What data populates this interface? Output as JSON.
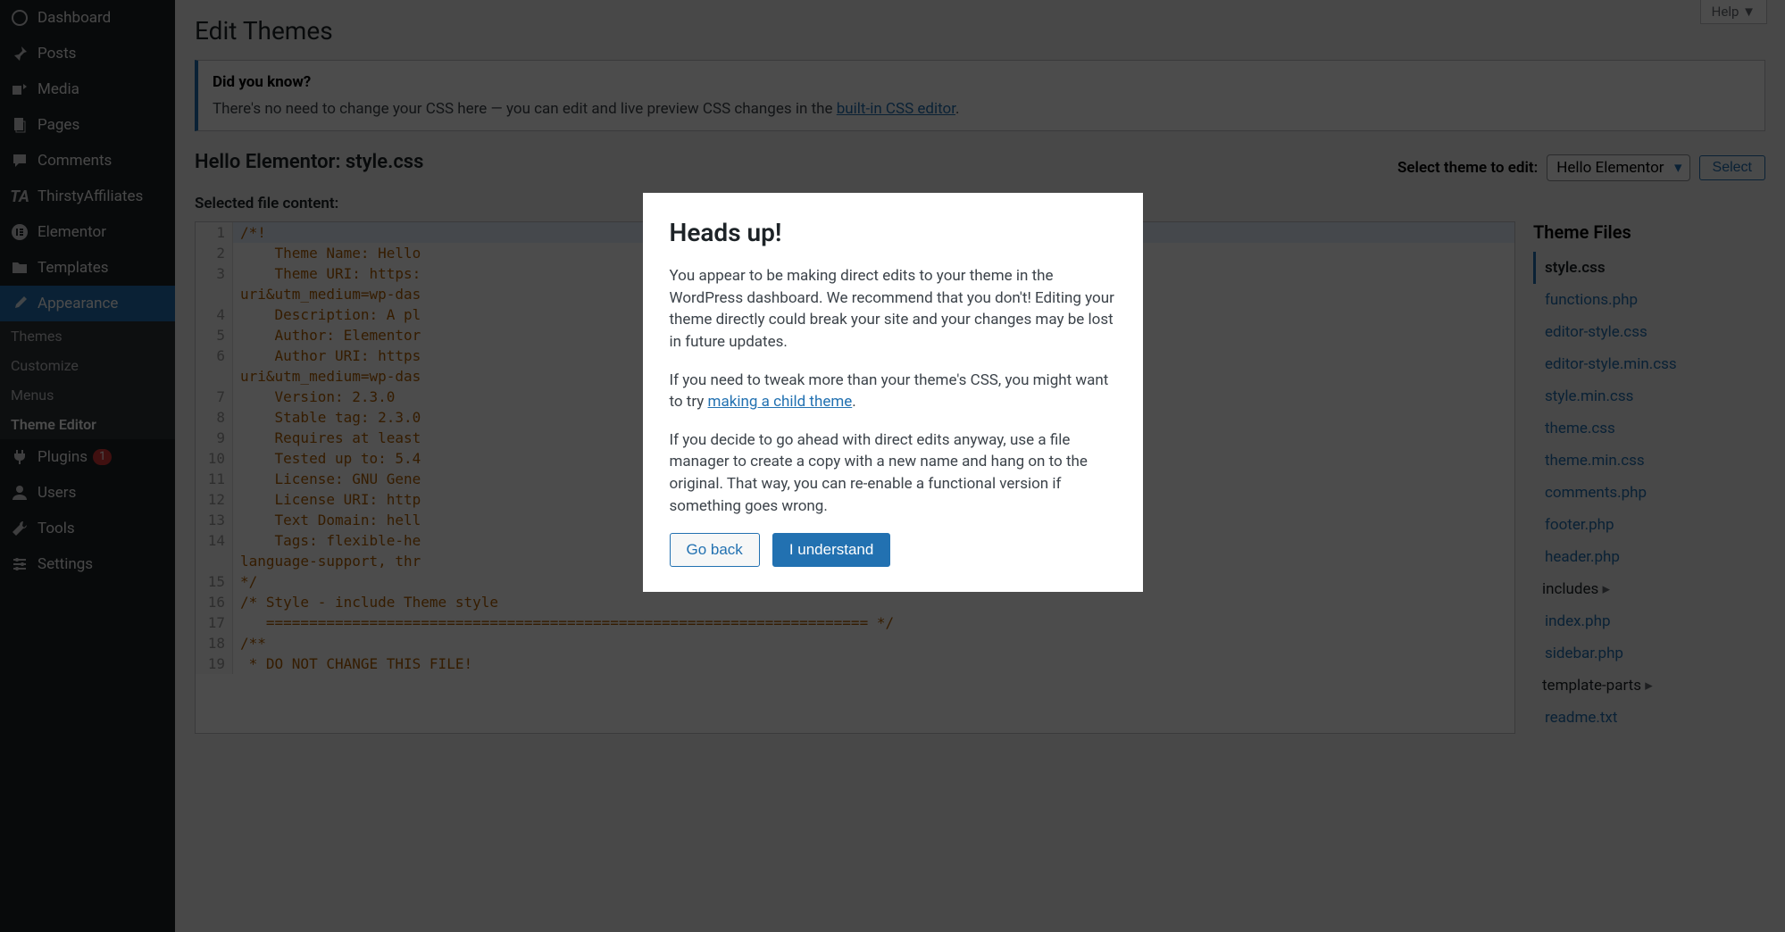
{
  "sidebar": {
    "items": [
      {
        "label": "Dashboard",
        "icon": "dashboard"
      },
      {
        "label": "Posts",
        "icon": "pin"
      },
      {
        "label": "Media",
        "icon": "media"
      },
      {
        "label": "Pages",
        "icon": "page"
      },
      {
        "label": "Comments",
        "icon": "comment"
      },
      {
        "label": "ThirstyAffiliates",
        "icon": "ta"
      },
      {
        "label": "Elementor",
        "icon": "elementor"
      },
      {
        "label": "Templates",
        "icon": "folder"
      },
      {
        "label": "Appearance",
        "icon": "brush",
        "current": true
      },
      {
        "label": "Plugins",
        "icon": "plug",
        "badge": "1"
      },
      {
        "label": "Users",
        "icon": "user"
      },
      {
        "label": "Tools",
        "icon": "wrench"
      },
      {
        "label": "Settings",
        "icon": "settings"
      }
    ],
    "submenu": [
      {
        "label": "Themes"
      },
      {
        "label": "Customize"
      },
      {
        "label": "Menus"
      },
      {
        "label": "Theme Editor",
        "active": true
      }
    ]
  },
  "help_tab": "Help",
  "page_title": "Edit Themes",
  "info_box": {
    "heading": "Did you know?",
    "text_prefix": "There's no need to change your CSS here — you can edit and live preview CSS changes in the ",
    "link_text": "built-in CSS editor",
    "text_suffix": "."
  },
  "file_heading": "Hello Elementor: style.css",
  "theme_select": {
    "label": "Select theme to edit:",
    "value": "Hello Elementor",
    "button": "Select"
  },
  "content_label": "Selected file content:",
  "code_lines": [
    "/*!",
    "    Theme Name: Hello",
    "    Theme URI: https:                                                           aign=theme-uri&utm_medium=wp-das",
    "    Description: A pl",
    "    Author: Elementor",
    "    Author URI: https                                                            -uri&utm_medium=wp-das",
    "    Version: 2.3.0",
    "    Stable tag: 2.3.0",
    "    Requires at least",
    "    Tested up to: 5.4",
    "    License: GNU Gene",
    "    License URI: http",
    "    Text Domain: hell",
    "    Tags: flexible-he                                                           ages, rtl-language-support, thr",
    "*/",
    "/* Style - include Theme style",
    "   ====================================================================== */",
    "/**",
    " * DO NOT CHANGE THIS FILE!"
  ],
  "theme_files": {
    "heading": "Theme Files",
    "files": [
      {
        "name": "style.css",
        "active": true
      },
      {
        "name": "functions.php"
      },
      {
        "name": "editor-style.css"
      },
      {
        "name": "editor-style.min.css"
      },
      {
        "name": "style.min.css"
      },
      {
        "name": "theme.css"
      },
      {
        "name": "theme.min.css"
      },
      {
        "name": "comments.php"
      },
      {
        "name": "footer.php"
      },
      {
        "name": "header.php"
      },
      {
        "name": "includes",
        "folder": true
      },
      {
        "name": "index.php"
      },
      {
        "name": "sidebar.php"
      },
      {
        "name": "template-parts",
        "folder": true
      },
      {
        "name": "readme.txt"
      }
    ]
  },
  "modal": {
    "title": "Heads up!",
    "p1": "You appear to be making direct edits to your theme in the WordPress dashboard. We recommend that you don't! Editing your theme directly could break your site and your changes may be lost in future updates.",
    "p2_prefix": "If you need to tweak more than your theme's CSS, you might want to try ",
    "p2_link": "making a child theme",
    "p2_suffix": ".",
    "p3": "If you decide to go ahead with direct edits anyway, use a file manager to create a copy with a new name and hang on to the original. That way, you can re-enable a functional version if something goes wrong.",
    "go_back": "Go back",
    "understand": "I understand"
  }
}
